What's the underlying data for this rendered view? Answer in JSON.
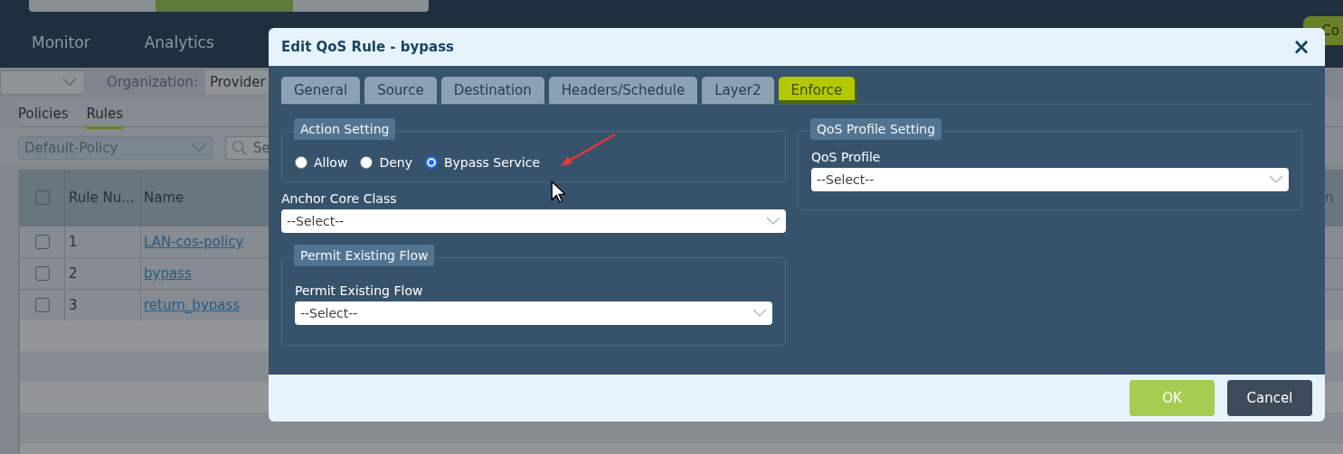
{
  "top_tabs": [
    {
      "selected": false
    },
    {
      "selected": true
    },
    {
      "selected": false
    }
  ],
  "nav": {
    "items": [
      "Monitor",
      "Analytics"
    ],
    "right_button": "Co"
  },
  "filter": {
    "organization_label": "Organization:",
    "organization_value": "Provider"
  },
  "subtabs": [
    {
      "label": "Policies",
      "selected": false
    },
    {
      "label": "Rules",
      "selected": true
    }
  ],
  "policy_select": "Default-Policy",
  "search": {
    "placeholder": "Se"
  },
  "table": {
    "header_checked": false,
    "columns": [
      "Rule Nu...",
      "Name"
    ],
    "column_4": "n",
    "rows": [
      {
        "checked": false,
        "number": "1",
        "name": "LAN-cos-policy"
      },
      {
        "checked": false,
        "number": "2",
        "name": "bypass"
      },
      {
        "checked": false,
        "number": "3",
        "name": "return_bypass"
      }
    ]
  },
  "dialog": {
    "title": "Edit QoS Rule - bypass",
    "close": "×",
    "tabs": [
      {
        "label": "General",
        "selected": false
      },
      {
        "label": "Source",
        "selected": false
      },
      {
        "label": "Destination",
        "selected": false
      },
      {
        "label": "Headers/Schedule",
        "selected": false
      },
      {
        "label": "Layer2",
        "selected": false
      },
      {
        "label": "Enforce",
        "selected": true
      }
    ],
    "action_setting": {
      "legend": "Action Setting",
      "options": [
        {
          "label": "Allow",
          "selected": false
        },
        {
          "label": "Deny",
          "selected": false
        },
        {
          "label": "Bypass Service",
          "selected": true
        }
      ]
    },
    "anchor_core_class": {
      "label": "Anchor Core Class",
      "value": "--Select--"
    },
    "permit_existing_flow": {
      "legend": "Permit Existing Flow",
      "label": "Permit Existing Flow",
      "value": "--Select--"
    },
    "qos_profile_setting": {
      "legend": "QoS Profile Setting",
      "label": "QoS Profile",
      "value": "--Select--"
    },
    "buttons": [
      {
        "label": "OK",
        "kind": "primary"
      },
      {
        "label": "Cancel",
        "kind": "secondary"
      }
    ]
  }
}
